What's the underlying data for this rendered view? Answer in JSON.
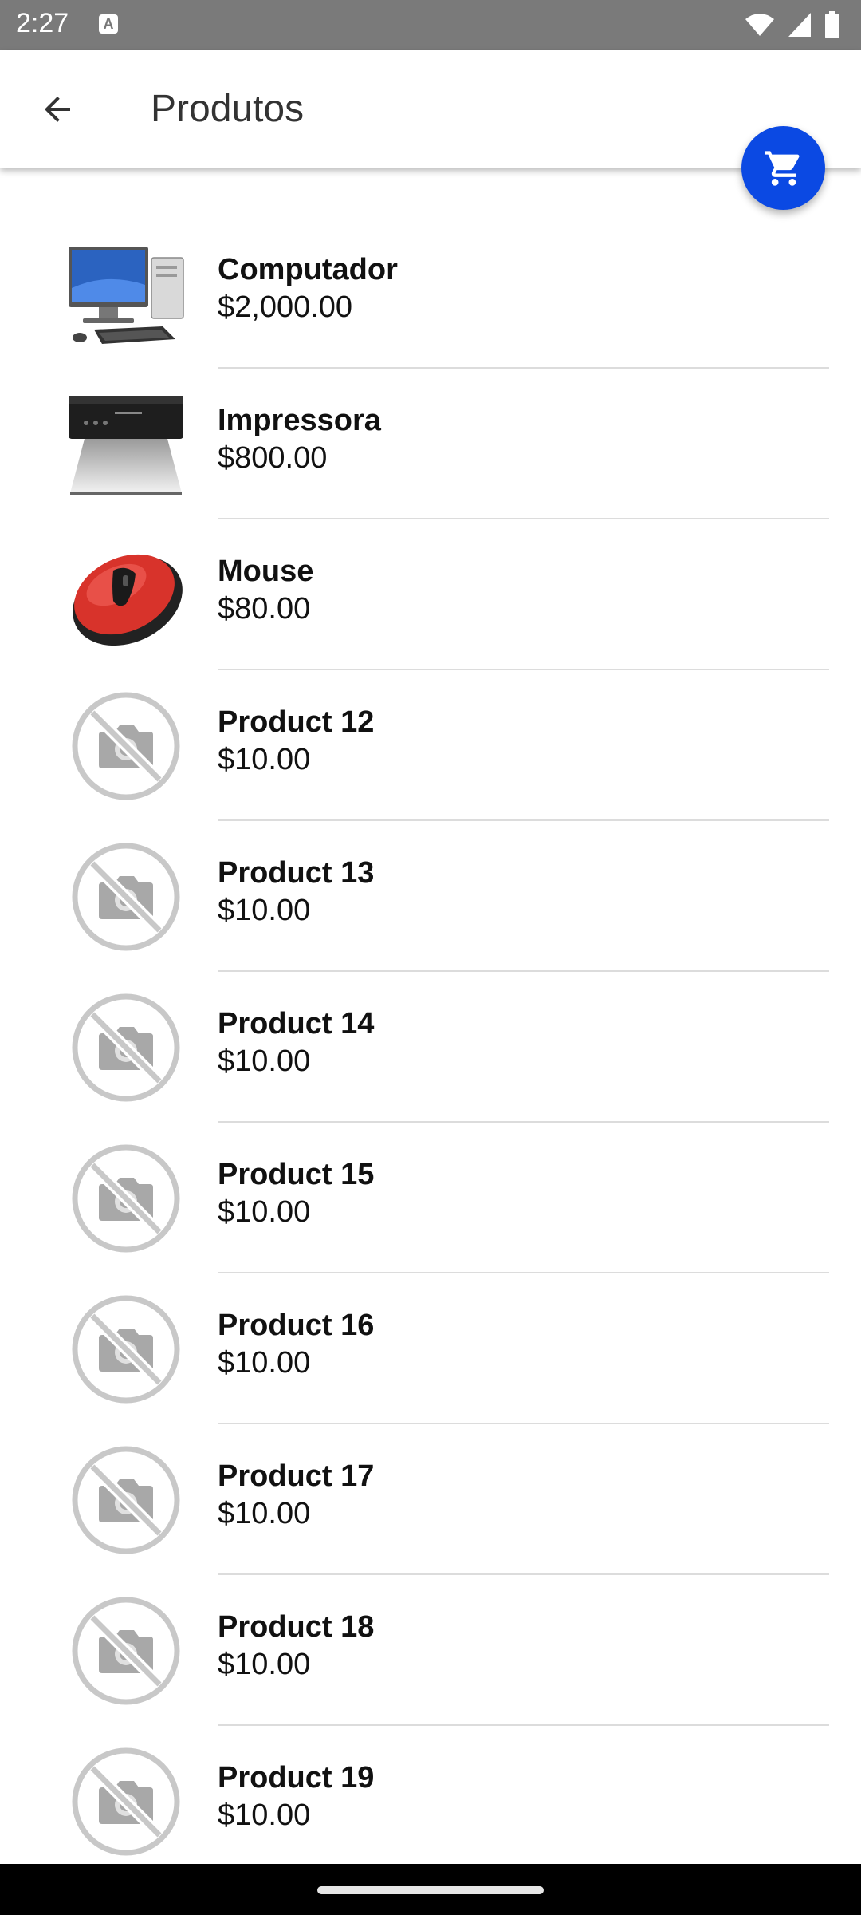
{
  "status_bar": {
    "time": "2:27",
    "indicator": "A",
    "icons": [
      "wifi-icon",
      "signal-icon",
      "battery-icon"
    ]
  },
  "app_bar": {
    "title": "Produtos",
    "back_icon": "arrow-back-icon"
  },
  "fab": {
    "icon": "cart-icon",
    "color": "#0b49e3"
  },
  "products": [
    {
      "name": "Computador",
      "price": "$2,000.00",
      "image": "computer"
    },
    {
      "name": "Impressora",
      "price": "$800.00",
      "image": "printer"
    },
    {
      "name": "Mouse",
      "price": "$80.00",
      "image": "mouse"
    },
    {
      "name": "Product 12",
      "price": "$10.00",
      "image": "no-photo"
    },
    {
      "name": "Product 13",
      "price": "$10.00",
      "image": "no-photo"
    },
    {
      "name": "Product 14",
      "price": "$10.00",
      "image": "no-photo"
    },
    {
      "name": "Product 15",
      "price": "$10.00",
      "image": "no-photo"
    },
    {
      "name": "Product 16",
      "price": "$10.00",
      "image": "no-photo"
    },
    {
      "name": "Product 17",
      "price": "$10.00",
      "image": "no-photo"
    },
    {
      "name": "Product 18",
      "price": "$10.00",
      "image": "no-photo"
    },
    {
      "name": "Product 19",
      "price": "$10.00",
      "image": "no-photo"
    }
  ]
}
